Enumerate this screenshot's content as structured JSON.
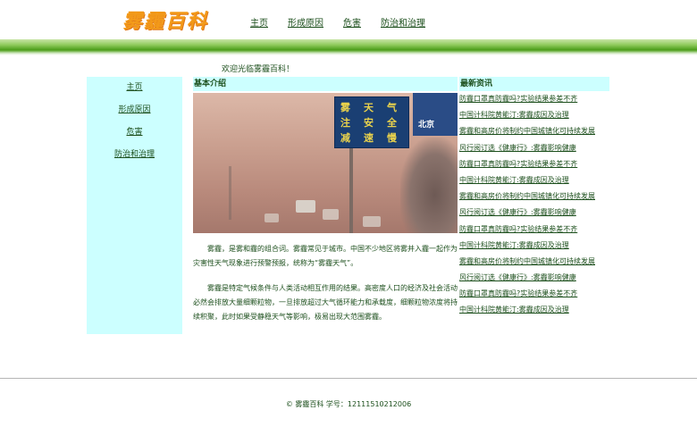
{
  "header": {
    "logo": "雾霾百科",
    "nav": [
      "主页",
      "形成原因",
      "危害",
      "防治和治理"
    ]
  },
  "welcome": "欢迎光临雾霾百科！",
  "sidebar": {
    "items": [
      "主页",
      "形成原因",
      "危害",
      "防治和治理"
    ]
  },
  "main": {
    "title": "基本介绍",
    "photo": {
      "sign_text": [
        "雾",
        "天",
        "气",
        "注",
        "安",
        "全",
        "减",
        "速",
        "慢",
        "行"
      ],
      "sign2_text": "北京"
    },
    "paragraphs": [
      "雾霾，是雾和霾的组合词。雾霾常见于城市。中国不少地区将雾并入霾一起作为灾害性天气现象进行预警预报，统称为“雾霾天气”。",
      "雾霾是特定气候条件与人类活动相互作用的结果。高密度人口的经济及社会活动必然会排放大量细颗粒物，一旦排放超过大气循环能力和承载度，细颗粒物浓度将持续积聚，此时如果受静稳天气等影响，极易出现大范围雾霾。"
    ]
  },
  "news": {
    "title": "最新资讯",
    "items": [
      "防霾口罩真防霾吗?实验结果参差不齐",
      "中国计科院黄能汀:雾霾成因及治理",
      "雾霾和高房价将制约中国城镇化可持续发展",
      "风行阅订选《健康行》:雾霾影响健康",
      "防霾口罩真防霾吗?实验结果参差不齐",
      "中国计科院黄能汀:雾霾成因及治理",
      "雾霾和高房价将制约中国城镇化可持续发展",
      "风行阅订选《健康行》:雾霾影响健康",
      "防霾口罩真防霾吗?实验结果参差不齐",
      "中国计科院黄能汀:雾霾成因及治理",
      "雾霾和高房价将制约中国城镇化可持续发展",
      "风行阅订选《健康行》:雾霾影响健康",
      "防霾口罩真防霾吗?实验结果参差不齐",
      "中国计科院黄能汀:雾霾成因及治理"
    ]
  },
  "footer": "© 雾霾百科 学号：12111510212006",
  "colors": {
    "text": "#1c4f1c",
    "logo": "#f39a19",
    "panel_bg": "#ccffff",
    "band_green": "#4e9e1c"
  }
}
